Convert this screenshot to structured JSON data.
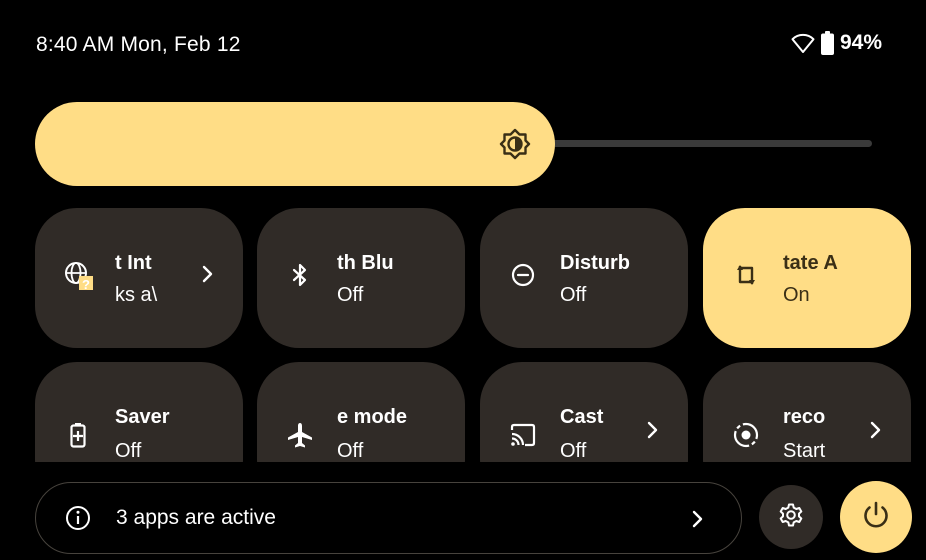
{
  "status_bar": {
    "time_date": "8:40 AM Mon, Feb 12",
    "wifi_icon": "wifi-outline-icon",
    "battery_icon": "battery-icon",
    "battery_percent": "94%"
  },
  "brightness": {
    "level": 0.62,
    "icon": "brightness-auto-icon"
  },
  "colors": {
    "accent": "#ffdd86",
    "tile_inactive": "#302b27",
    "background": "#000000"
  },
  "tiles": [
    {
      "label": "t  Int",
      "secondary": "ks a\\",
      "icon": "globe-question-icon",
      "active": true,
      "has_chevron": true
    },
    {
      "label": "th   Blu",
      "secondary": "Off",
      "icon": "bluetooth-icon",
      "active": false,
      "has_chevron": false
    },
    {
      "label": "Disturb",
      "secondary": "Off",
      "icon": "do-not-disturb-icon",
      "active": false,
      "has_chevron": false
    },
    {
      "label": "tate    A",
      "secondary": "On",
      "icon": "auto-rotate-icon",
      "active": true,
      "has_chevron": false
    },
    {
      "label": "Saver",
      "secondary": "Off",
      "icon": "battery-saver-icon",
      "active": false,
      "has_chevron": false
    },
    {
      "label": "e mode",
      "secondary": "Off",
      "icon": "airplane-icon",
      "active": false,
      "has_chevron": false
    },
    {
      "label": "Cast",
      "secondary": "Off",
      "icon": "cast-icon",
      "active": false,
      "has_chevron": true
    },
    {
      "label": "reco",
      "secondary": "Start",
      "icon": "screen-record-icon",
      "active": false,
      "has_chevron": true
    }
  ],
  "footer": {
    "apps_active_text": "3 apps are active",
    "info_icon": "info-icon",
    "settings_icon": "gear-icon",
    "power_icon": "power-icon"
  }
}
